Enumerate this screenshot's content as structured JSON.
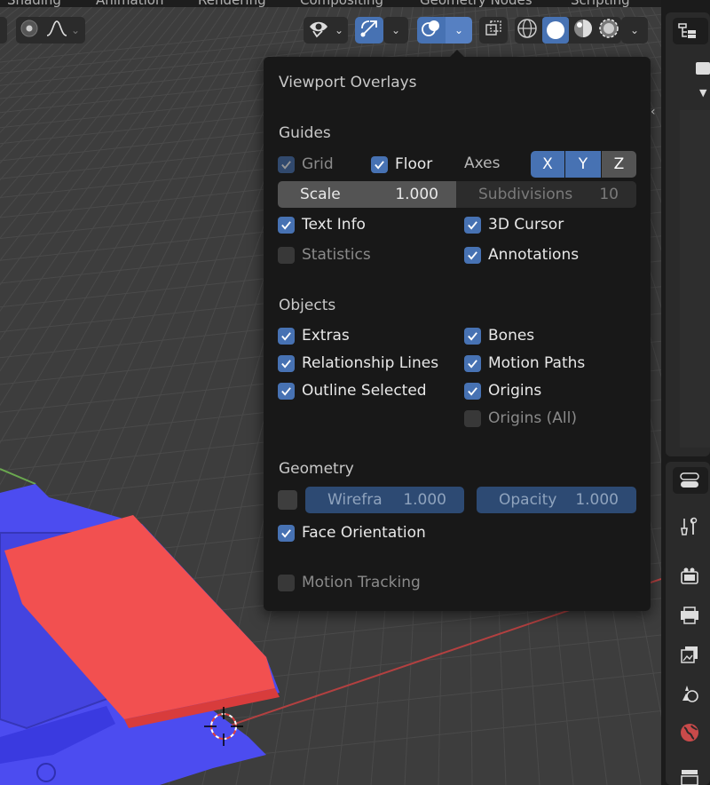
{
  "workspace_tabs": [
    "Shading",
    "Animation",
    "Rendering",
    "Compositing",
    "Geometry Nodes",
    "Scripting"
  ],
  "popup": {
    "title": "Viewport Overlays",
    "guides": {
      "heading": "Guides",
      "grid": "Grid",
      "floor": "Floor",
      "axes_label": "Axes",
      "axis_x": "X",
      "axis_y": "Y",
      "axis_z": "Z",
      "scale_label": "Scale",
      "scale_value": "1.000",
      "subdiv_label": "Subdivisions",
      "subdiv_value": "10",
      "text_info": "Text Info",
      "cursor_3d": "3D Cursor",
      "statistics": "Statistics",
      "annotations": "Annotations"
    },
    "objects": {
      "heading": "Objects",
      "extras": "Extras",
      "bones": "Bones",
      "relationship_lines": "Relationship Lines",
      "motion_paths": "Motion Paths",
      "outline_selected": "Outline Selected",
      "origins": "Origins",
      "origins_all": "Origins (All)"
    },
    "geometry": {
      "heading": "Geometry",
      "wireframe_label": "Wirefra",
      "wireframe_value": "1.000",
      "opacity_label": "Opacity",
      "opacity_value": "1.000",
      "face_orientation": "Face Orientation"
    },
    "motion_tracking": "Motion Tracking"
  },
  "colors": {
    "accent": "#4772b3",
    "popup_bg": "#181818",
    "viewport_bg": "#3d3d3d",
    "mesh_front": "#4a4af0",
    "mesh_back": "#f04a4a"
  },
  "icons": {
    "header": [
      "pivot-icon",
      "curve-falloff-icon",
      "visibility-icon",
      "gizmo-icon",
      "overlays-icon",
      "xray-icon",
      "wireframe-shading-icon",
      "solid-shading-icon",
      "material-shading-icon",
      "rendered-shading-icon"
    ],
    "properties": [
      "outliner-icon",
      "tool-icon",
      "render-icon",
      "output-icon",
      "view-layer-icon",
      "scene-icon",
      "world-icon"
    ]
  }
}
